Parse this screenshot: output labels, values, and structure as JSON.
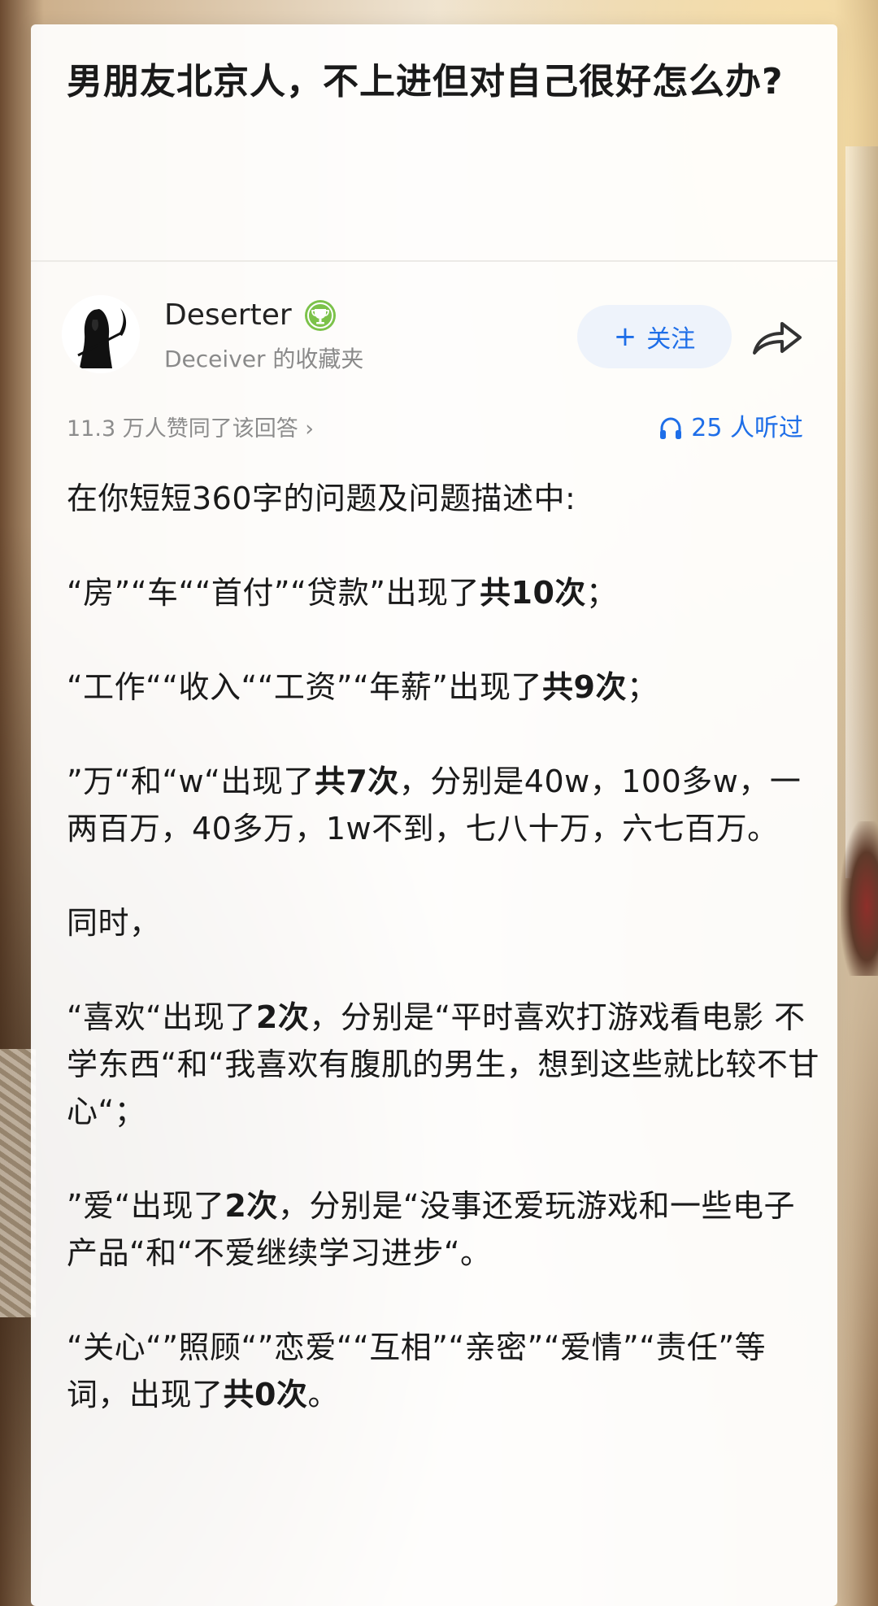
{
  "question": {
    "title": "男朋友北京人，不上进但对自己很好怎么办?"
  },
  "author": {
    "name": "Deserter",
    "collection": "Deceiver 的收藏夹",
    "badge_icon": "trophy-badge-icon",
    "follow_label": "关注",
    "follow_icon": "plus",
    "share_icon": "share-arrow-icon"
  },
  "stats": {
    "likes": "11.3 万人赞同了该回答 ›",
    "listened": "25 人听过",
    "listened_icon": "headphones-icon"
  },
  "answer": {
    "p1": "在你短短360字的问题及问题描述中:",
    "p2_pre": "“房”“车““首付”“贷款”出现了",
    "p2_bold": "共10次",
    "p2_post": "；",
    "p3_pre": "“工作““收入““工资”“年薪”出现了",
    "p3_bold": "共9次",
    "p3_post": "；",
    "p4_pre": "”万“和“w“出现了",
    "p4_bold": "共7次",
    "p4_post": "，分别是40w，100多w，一两百万，40多万，1w不到，七八十万，六七百万。",
    "p5": "同时，",
    "p6_pre": "“喜欢“出现了",
    "p6_bold": "2次",
    "p6_post": "，分别是“平时喜欢打游戏看电影 不学东西“和“我喜欢有腹肌的男生，想到这些就比较不甘心“；",
    "p7_pre": "”爱“出现了",
    "p7_bold": "2次",
    "p7_post": "，分别是“没事还爱玩游戏和一些电子产品“和“不爱继续学习进步“。",
    "p8_pre": "“关心“”照顾“”恋爱““互相”“亲密”“爱情”“责任”等词，出现了",
    "p8_bold": "共0次",
    "p8_post": "。"
  },
  "colors": {
    "accent": "#1e6ee8",
    "follow_bg": "#eef3fb",
    "muted_text": "#8a8a8a",
    "badge_green": "#7cc24a"
  }
}
